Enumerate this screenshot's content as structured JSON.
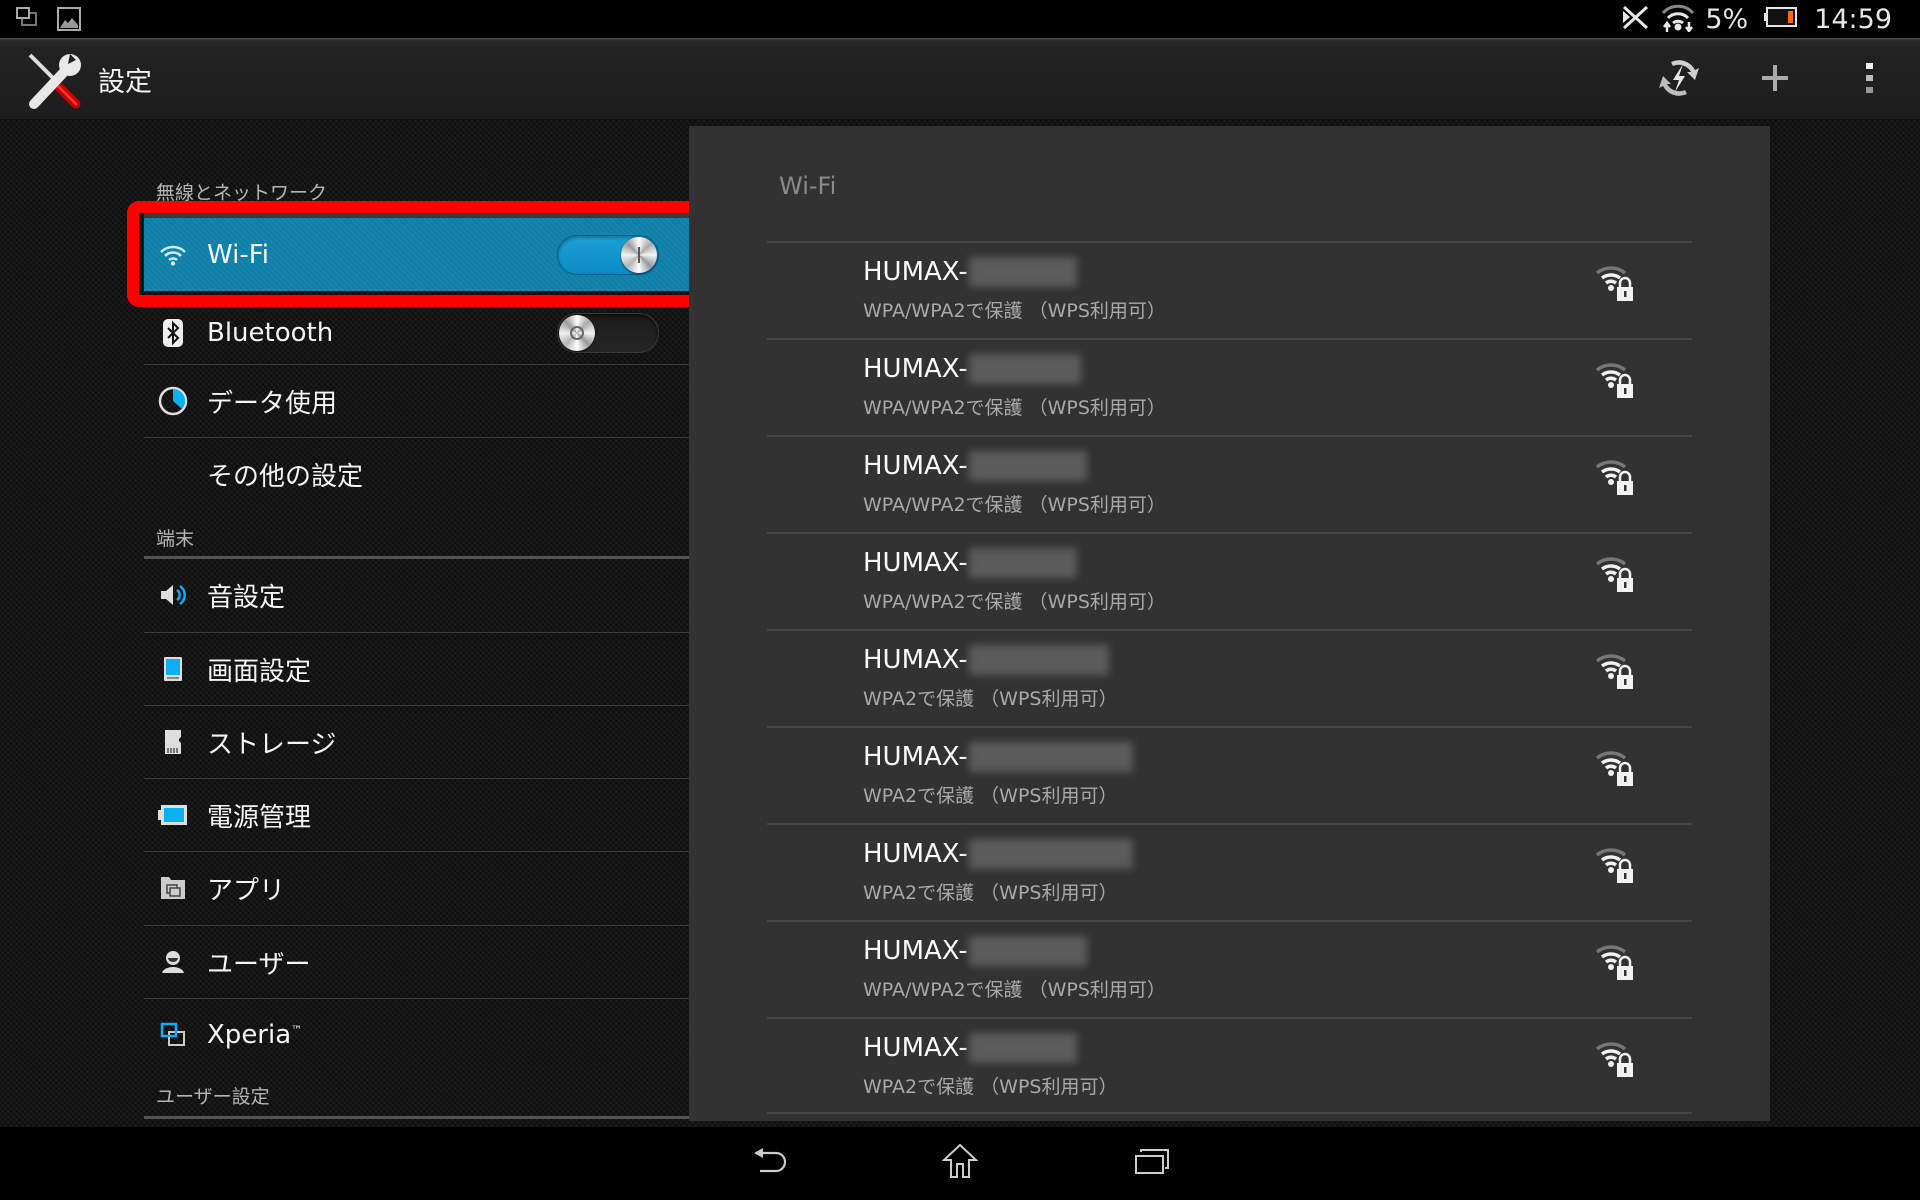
{
  "status_bar": {
    "notification_icons": [
      "multi-window-icon",
      "gallery-image-icon"
    ],
    "status_icons": [
      "nfc-off-icon",
      "wifi-data-activity-icon",
      "battery-low-icon"
    ],
    "battery_percent": "5%",
    "time": "14:59"
  },
  "action_bar": {
    "app_icon": "settings-tools-icon",
    "title": "設定",
    "actions": [
      {
        "name": "wps-button",
        "icon": "wps-icon"
      },
      {
        "name": "add-network-button",
        "icon": "plus-icon"
      },
      {
        "name": "overflow-menu-button",
        "icon": "overflow-menu-icon"
      }
    ]
  },
  "sidebar": {
    "sections": [
      {
        "header": "無線とネットワーク"
      },
      {
        "header": "端末"
      },
      {
        "header": "ユーザー設定"
      }
    ],
    "items": [
      {
        "label": "Wi-Fi",
        "icon": "wifi-icon",
        "selected": true,
        "toggle": "on"
      },
      {
        "label": "Bluetooth",
        "icon": "bluetooth-icon",
        "selected": false,
        "toggle": "off"
      },
      {
        "label": "データ使用",
        "icon": "data-usage-icon",
        "selected": false
      },
      {
        "label": "その他の設定",
        "icon": "",
        "selected": false
      },
      {
        "label": "音設定",
        "icon": "speaker-icon",
        "selected": false
      },
      {
        "label": "画面設定",
        "icon": "display-icon",
        "selected": false
      },
      {
        "label": "ストレージ",
        "icon": "sd-card-icon",
        "selected": false
      },
      {
        "label": "電源管理",
        "icon": "battery-icon",
        "selected": false
      },
      {
        "label": "アプリ",
        "icon": "apps-icon",
        "selected": false
      },
      {
        "label": "ユーザー",
        "icon": "user-icon",
        "selected": false
      },
      {
        "label": "Xperia",
        "label_suffix": "™",
        "icon": "xperia-connectivity-icon",
        "selected": false
      }
    ]
  },
  "highlight": {
    "color": "#ff0000",
    "target": "Wi-Fi"
  },
  "wifi_panel": {
    "title": "Wi-Fi",
    "networks": [
      {
        "ssid_visible": "HUMAX-",
        "ssid_redacted": true,
        "security": "WPA/WPA2で保護 （WPS利用可）",
        "signal_bars": 3,
        "signal_max": 4,
        "locked": true
      },
      {
        "ssid_visible": "HUMAX-",
        "ssid_redacted": true,
        "security": "WPA/WPA2で保護 （WPS利用可）",
        "signal_bars": 3,
        "signal_max": 4,
        "locked": true
      },
      {
        "ssid_visible": "HUMAX-",
        "ssid_redacted": true,
        "security": "WPA/WPA2で保護 （WPS利用可）",
        "signal_bars": 3,
        "signal_max": 4,
        "locked": true
      },
      {
        "ssid_visible": "HUMAX-",
        "ssid_redacted": true,
        "security": "WPA/WPA2で保護 （WPS利用可）",
        "signal_bars": 3,
        "signal_max": 4,
        "locked": true
      },
      {
        "ssid_visible": "HUMAX-",
        "ssid_redacted": true,
        "security": "WPA2で保護 （WPS利用可）",
        "signal_bars": 3,
        "signal_max": 4,
        "locked": true
      },
      {
        "ssid_visible": "HUMAX-",
        "ssid_redacted": true,
        "security": "WPA2で保護 （WPS利用可）",
        "signal_bars": 3,
        "signal_max": 4,
        "locked": true
      },
      {
        "ssid_visible": "HUMAX-",
        "ssid_redacted": true,
        "security": "WPA2で保護 （WPS利用可）",
        "signal_bars": 3,
        "signal_max": 4,
        "locked": true
      },
      {
        "ssid_visible": "HUMAX-",
        "ssid_redacted": true,
        "security": "WPA/WPA2で保護 （WPS利用可）",
        "signal_bars": 3,
        "signal_max": 4,
        "locked": true
      },
      {
        "ssid_visible": "HUMAX-",
        "ssid_redacted": true,
        "security": "WPA2で保護 （WPS利用可）",
        "signal_bars": 3,
        "signal_max": 4,
        "locked": true
      }
    ]
  },
  "nav_bar": {
    "buttons": [
      {
        "name": "back-button",
        "icon": "back-icon"
      },
      {
        "name": "home-button",
        "icon": "home-icon"
      },
      {
        "name": "recents-button",
        "icon": "recent-apps-icon"
      }
    ]
  },
  "colors": {
    "accent": "#0e7fa8",
    "toggle_on": "#1ea0d6",
    "panel_bg": "#323232",
    "battery_low": "#ff6a00"
  }
}
